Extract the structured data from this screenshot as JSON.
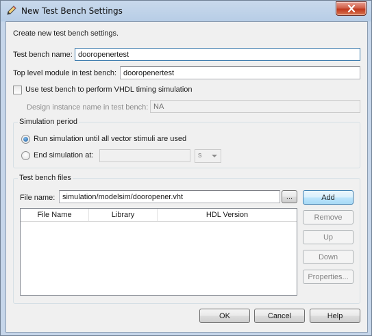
{
  "window": {
    "title": "New Test Bench Settings"
  },
  "intro": "Create new test bench settings.",
  "testbench_name": {
    "label": "Test bench name:",
    "value": "dooropenertest"
  },
  "top_level_module": {
    "label": "Top level module in test bench:",
    "value": "dooropenertest"
  },
  "vhdl_timing": {
    "label": "Use test bench to perform VHDL timing simulation",
    "checked": false
  },
  "design_instance": {
    "label": "Design instance name in test bench:",
    "value": "NA"
  },
  "simulation_period": {
    "legend": "Simulation period",
    "run_until_label": "Run simulation until all vector stimuli are used",
    "end_at_label": "End simulation at:",
    "end_at_value": "",
    "unit": "s"
  },
  "testbench_files": {
    "legend": "Test bench files",
    "file_name_label": "File name:",
    "file_name_value": "simulation/modelsim/dooropener.vht",
    "browse_label": "...",
    "add_label": "Add",
    "remove_label": "Remove",
    "up_label": "Up",
    "down_label": "Down",
    "properties_label": "Properties...",
    "columns": [
      "File Name",
      "Library",
      "HDL Version"
    ]
  },
  "buttons": {
    "ok": "OK",
    "cancel": "Cancel",
    "help": "Help"
  },
  "colors": {
    "titlebar": "#b7cde6",
    "client": "#f0f0f0",
    "close": "#c0391e",
    "default_button": "#a7d9f5"
  }
}
